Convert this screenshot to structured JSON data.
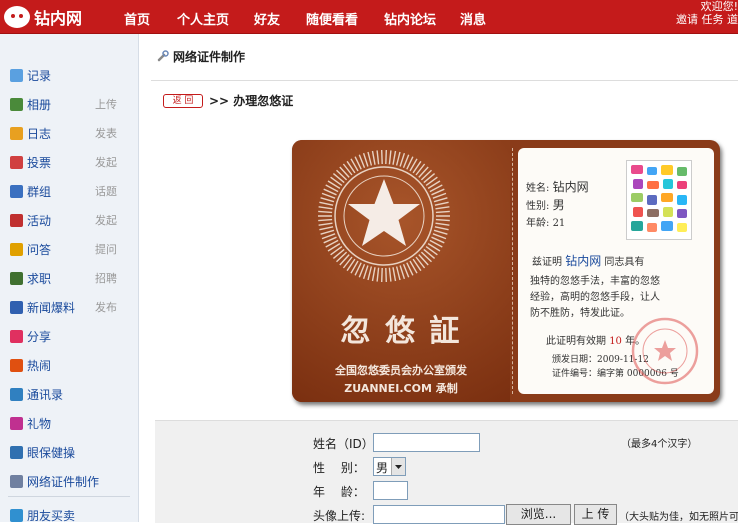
{
  "topbar": {
    "logo": "钻内网",
    "nav": [
      "首页",
      "个人主页",
      "好友",
      "随便看看",
      "钻内论坛",
      "消息"
    ],
    "welcome": "欢迎您!",
    "links": "邀请 任务 道"
  },
  "sidebar": {
    "items": [
      {
        "label": "记录",
        "sub": "",
        "icon": "chat-icon",
        "color": "#5aa0e0"
      },
      {
        "label": "相册",
        "sub": "上传",
        "icon": "photo-icon",
        "color": "#4a8a3a"
      },
      {
        "label": "日志",
        "sub": "发表",
        "icon": "blog-icon",
        "color": "#e8a020"
      },
      {
        "label": "投票",
        "sub": "发起",
        "icon": "vote-icon",
        "color": "#d04040"
      },
      {
        "label": "群组",
        "sub": "话题",
        "icon": "group-icon",
        "color": "#3a70c0"
      },
      {
        "label": "活动",
        "sub": "发起",
        "icon": "event-icon",
        "color": "#c03030"
      },
      {
        "label": "问答",
        "sub": "提问",
        "icon": "question-icon",
        "color": "#e0a000"
      },
      {
        "label": "求职",
        "sub": "招聘",
        "icon": "job-icon",
        "color": "#407030"
      },
      {
        "label": "新闻爆料",
        "sub": "发布",
        "icon": "news-icon",
        "color": "#3060b0"
      },
      {
        "label": "分享",
        "sub": "",
        "icon": "share-icon",
        "color": "#e03060"
      },
      {
        "label": "热闹",
        "sub": "",
        "icon": "fire-icon",
        "color": "#e05010"
      },
      {
        "label": "通讯录",
        "sub": "",
        "icon": "contacts-icon",
        "color": "#3080c0"
      },
      {
        "label": "礼物",
        "sub": "",
        "icon": "gift-icon",
        "color": "#c03090"
      },
      {
        "label": "眼保健操",
        "sub": "",
        "icon": "eye-icon",
        "color": "#3070b0"
      },
      {
        "label": "网络证件制作",
        "sub": "",
        "icon": "wrench-icon",
        "color": "#7080a0"
      },
      {
        "label": "朋友买卖",
        "sub": "",
        "icon": "trade-icon",
        "color": "#3090d0"
      }
    ]
  },
  "main": {
    "title": "网络证件制作",
    "back": "返 回",
    "crumb": ">> 办理忽悠证"
  },
  "cert": {
    "big_title": "忽 悠 証",
    "issuer": "全国忽悠委员会办公室颁发",
    "site": "ZUANNEI.COM 承制",
    "name_label": "姓名:",
    "name": "钻内网",
    "sex_label": "性别:",
    "sex": "男",
    "age_label": "年龄:",
    "age": "21",
    "line1a": "兹证明",
    "line1b": "钻内网",
    "line1c": "同志具有",
    "body1": "独特的忽悠手法，丰富的忽悠",
    "body2": "经验，高明的忽悠手段，让人",
    "body3": "防不胜防，特发此证。",
    "valid_a": "此证明有效期",
    "valid_b": "10",
    "valid_c": "年。",
    "date": "颁发日期：2009-11-12",
    "serial": "证件编号：编字第 0000006 号"
  },
  "form": {
    "name_label": "姓名（ID）",
    "name_value": "",
    "name_hint": "（最多4个汉字）",
    "sex_label": "性　 别：",
    "sex_value": "男",
    "age_label": "年　 龄：",
    "age_value": "",
    "avatar_label": "头像上传:",
    "browse": "浏览...",
    "upload": "上 传",
    "avatar_hint": "（大头贴为佳，如无照片可"
  }
}
